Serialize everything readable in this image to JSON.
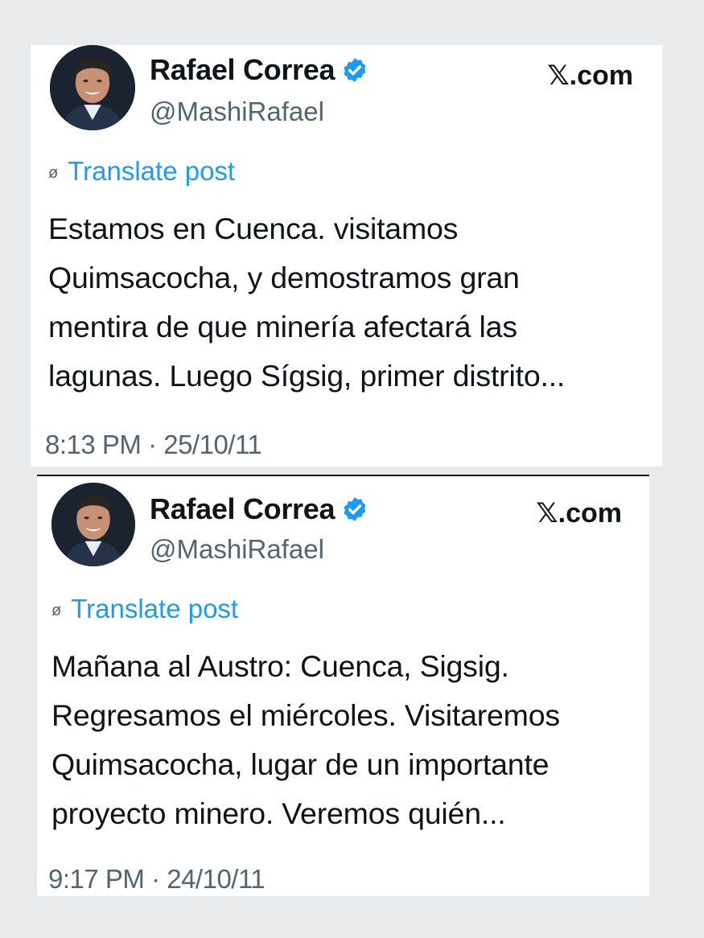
{
  "posts": [
    {
      "author_name": "Rafael Correa",
      "handle": "@MashiRafael",
      "brand": "𝕏.com",
      "translate_label": "Translate post",
      "text_lines": [
        "Estamos en Cuenca. visitamos",
        "Quimsacocha, y demostramos gran",
        "mentira de que minería afectará las",
        "lagunas. Luego Sígsig, primer distrito..."
      ],
      "timestamp": "8:13 PM · 25/10/11",
      "verified_color": "#1d9bf0",
      "avatar_icon": "profile-photo"
    },
    {
      "author_name": "Rafael Correa",
      "handle": "@MashiRafael",
      "brand": "𝕏.com",
      "translate_label": "Translate post",
      "text_lines": [
        "Mañana al Austro: Cuenca, Sigsig.",
        "Regresamos el miércoles. Visitaremos",
        "Quimsacocha, lugar de un importante",
        "proyecto minero. Veremos quién..."
      ],
      "timestamp": "9:17 PM · 24/10/11",
      "verified_color": "#1d9bf0",
      "avatar_icon": "profile-photo"
    }
  ],
  "colors": {
    "background": "#e9eaec",
    "link": "#1d9bf0",
    "text_primary": "#0f1419",
    "text_secondary": "#536471"
  }
}
